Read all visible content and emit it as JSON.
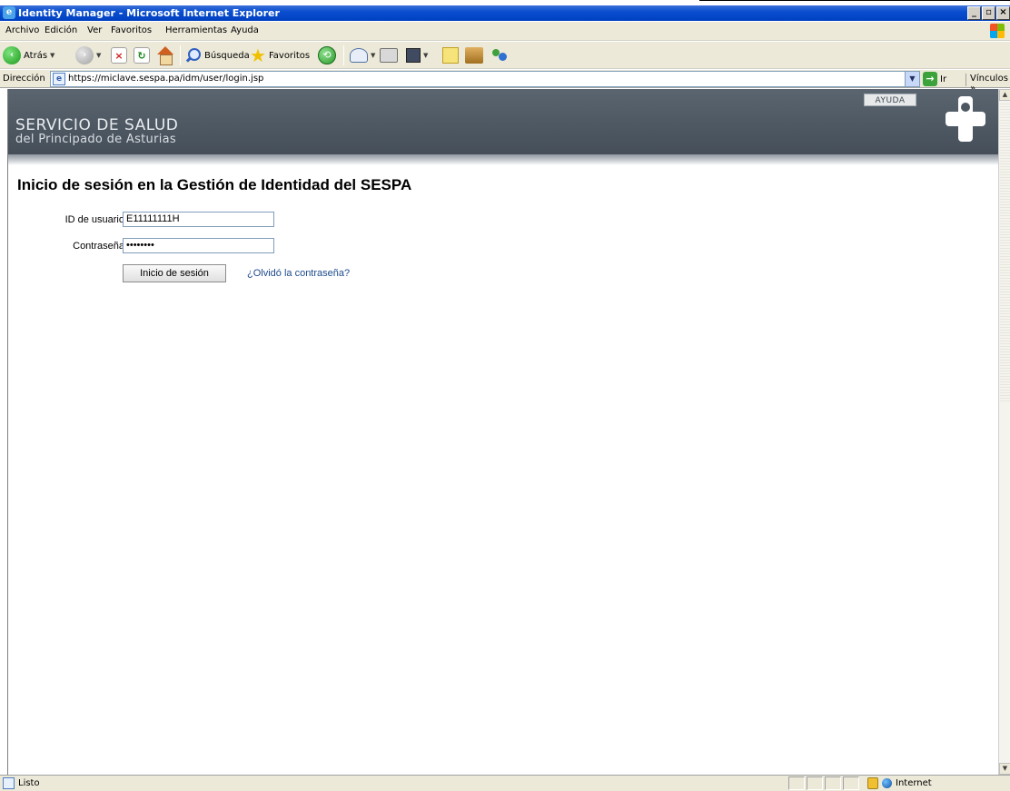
{
  "window": {
    "title": "Identity Manager - Microsoft Internet Explorer",
    "controls": [
      "_",
      "▫",
      "×"
    ]
  },
  "menubar": {
    "items": [
      "Archivo",
      "Edición",
      "Ver",
      "Favoritos",
      "Herramientas",
      "Ayuda"
    ]
  },
  "toolbar": {
    "back_label": "Atrás",
    "search_label": "Búsqueda",
    "favorites_label": "Favoritos"
  },
  "addressbar": {
    "label": "Dirección",
    "url": "https://miclave.sespa.pa/idm/user/login.jsp",
    "go_label": "Ir",
    "links_label": "Vínculos"
  },
  "page": {
    "brand_line1": "SERVICIO DE SALUD",
    "brand_line2": "del Principado de Asturias",
    "help_label": "AYUDA",
    "title": "Inicio de sesión en la Gestión de Identidad del SESPA",
    "user_label": "ID de usuario",
    "user_value": "E11111111H",
    "password_label": "Contraseña",
    "password_value": "••••••••",
    "login_button": "Inicio de sesión",
    "forgot_link": "¿Olvidó la contraseña?"
  },
  "statusbar": {
    "text": "Listo",
    "zone": "Internet"
  },
  "colors": {
    "header_bg": "#4d5762",
    "titlebar_bg": "#0a4fd0",
    "link": "#1d4a8c"
  }
}
